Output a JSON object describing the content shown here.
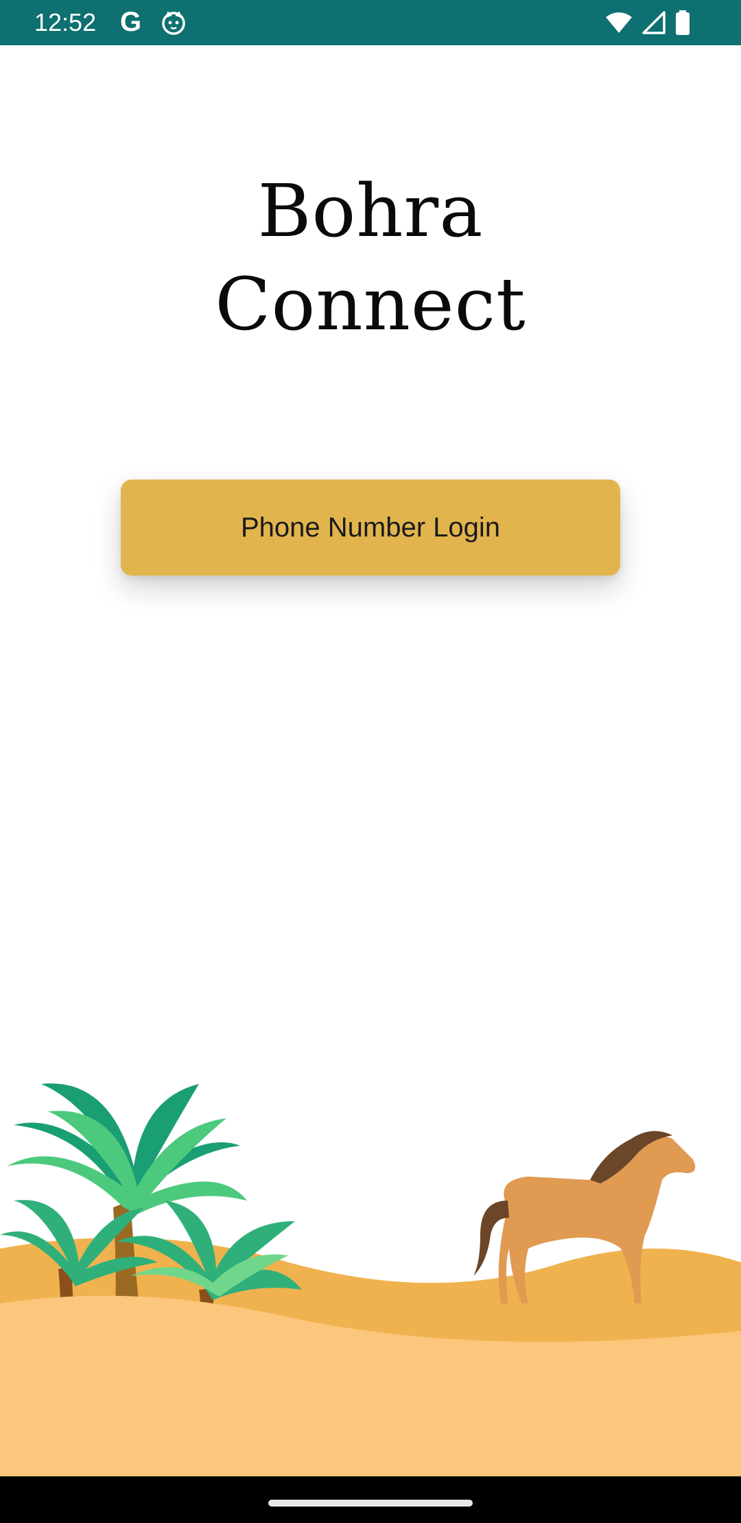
{
  "status_bar": {
    "time": "12:52",
    "google_glyph": "G",
    "icons": [
      "google-icon",
      "cat-notification-icon",
      "wifi-icon",
      "cellular-signal-icon",
      "battery-icon"
    ],
    "background": "#0e7070"
  },
  "app": {
    "title_line1": "Bohra",
    "title_line2": "Connect"
  },
  "login": {
    "button_label": "Phone Number Login",
    "button_color": "#e2b44e"
  },
  "illustration": {
    "elements": [
      "palm-trees",
      "sand-dunes",
      "horse"
    ],
    "sand_color": "#fcc77c",
    "palm_color": "#2fbf7f"
  },
  "nav_bar": {
    "background": "#000000"
  }
}
